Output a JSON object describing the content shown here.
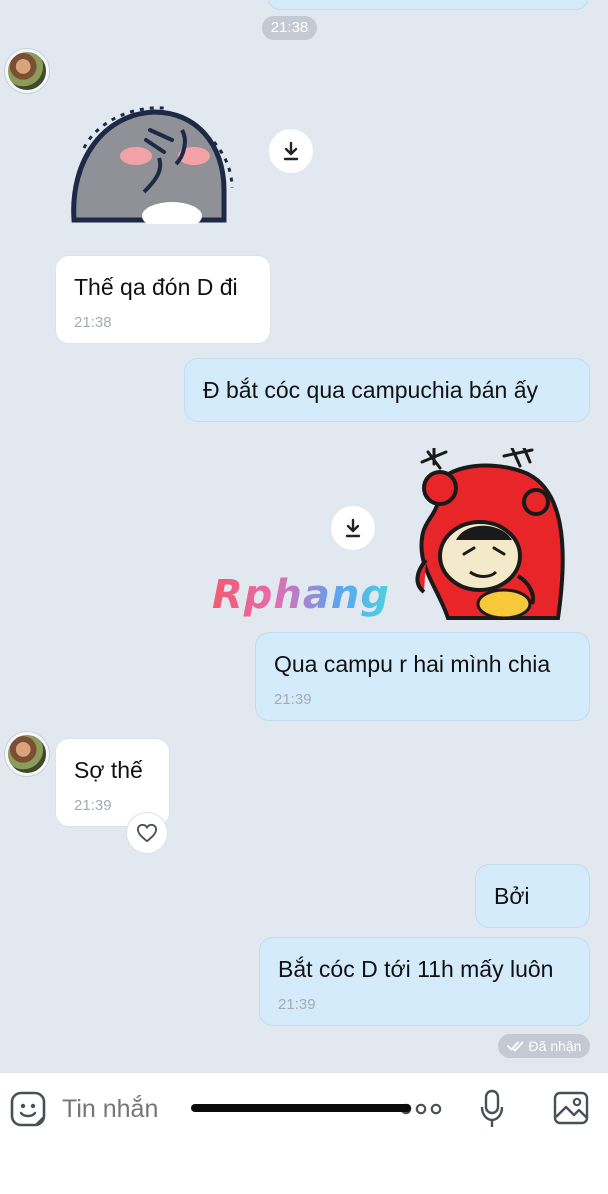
{
  "chat": {
    "top_time": "21:38",
    "messages": [
      {
        "id": "m1",
        "text": "Thế qa đón D đi",
        "time": "21:38",
        "direction": "incoming"
      },
      {
        "id": "m2",
        "text": "Đ bắt cóc qua campuchia bán ấy",
        "direction": "outgoing"
      },
      {
        "id": "m3",
        "text": "Qua campu r hai mình chia",
        "time": "21:39",
        "direction": "outgoing"
      },
      {
        "id": "m4",
        "text": "Sợ thế",
        "time": "21:39",
        "direction": "incoming"
      },
      {
        "id": "m5",
        "text": "Bởi",
        "direction": "outgoing"
      },
      {
        "id": "m6",
        "text": "Bắt cóc D tới 11h mấy luôn",
        "time": "21:39",
        "direction": "outgoing"
      }
    ],
    "received_status": "Đã nhận",
    "watermark": "Rphang"
  },
  "input_bar": {
    "placeholder": "Tin nhắn",
    "icons": [
      "sticker-icon",
      "more-icon",
      "microphone-icon",
      "image-icon"
    ]
  },
  "colors": {
    "background": "#e2e8f0",
    "incoming_bubble": "#ffffff",
    "outgoing_bubble": "#d3ebfb",
    "timestamp": "#a3abb5",
    "pill": "#c3cad3"
  }
}
